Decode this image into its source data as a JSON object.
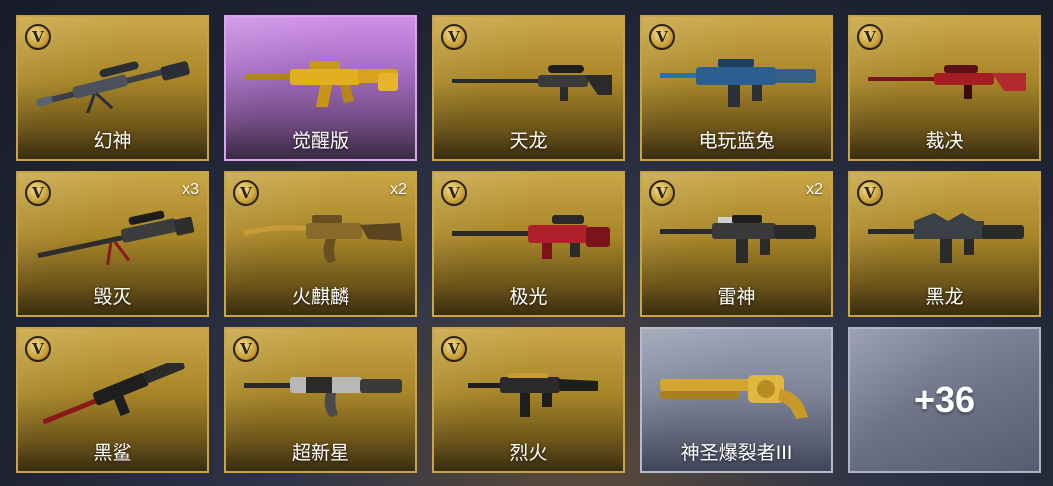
{
  "items": [
    {
      "name": "幻神",
      "badge": "V",
      "multiplier": "",
      "icon": "sniper-rifle-icon",
      "color": "#3a3f48"
    },
    {
      "name": "觉醒版",
      "badge": "",
      "multiplier": "",
      "icon": "assault-rifle-icon",
      "color": "#e0b020"
    },
    {
      "name": "天龙",
      "badge": "V",
      "multiplier": "",
      "icon": "sniper-rifle-icon",
      "color": "#2a2a2a"
    },
    {
      "name": "电玩蓝兔",
      "badge": "V",
      "multiplier": "",
      "icon": "assault-rifle-icon",
      "color": "#2f6fa8"
    },
    {
      "name": "裁决",
      "badge": "V",
      "multiplier": "",
      "icon": "sniper-rifle-icon",
      "color": "#a51e24"
    },
    {
      "name": "毁灭",
      "badge": "V",
      "multiplier": "x3",
      "icon": "sniper-rifle-icon",
      "color": "#2d2d2d"
    },
    {
      "name": "火麒麟",
      "badge": "V",
      "multiplier": "x2",
      "icon": "assault-rifle-icon",
      "color": "#8a6a2a"
    },
    {
      "name": "极光",
      "badge": "V",
      "multiplier": "",
      "icon": "sniper-rifle-icon",
      "color": "#b0202a"
    },
    {
      "name": "雷神",
      "badge": "V",
      "multiplier": "x2",
      "icon": "assault-rifle-icon",
      "color": "#2a2a2a"
    },
    {
      "name": "黑龙",
      "badge": "V",
      "multiplier": "",
      "icon": "assault-rifle-icon",
      "color": "#2a2a2a"
    },
    {
      "name": "黑鲨",
      "badge": "V",
      "multiplier": "",
      "icon": "assault-rifle-icon",
      "color": "#1e1e1e"
    },
    {
      "name": "超新星",
      "badge": "V",
      "multiplier": "",
      "icon": "assault-rifle-icon",
      "color": "#4a4a4a"
    },
    {
      "name": "烈火",
      "badge": "V",
      "multiplier": "",
      "icon": "smg-icon",
      "color": "#1e1e1e"
    },
    {
      "name": "神圣爆裂者III",
      "badge": "",
      "multiplier": "",
      "icon": "shotgun-icon",
      "color": "#d2a630"
    }
  ],
  "more": {
    "label": "+36"
  }
}
